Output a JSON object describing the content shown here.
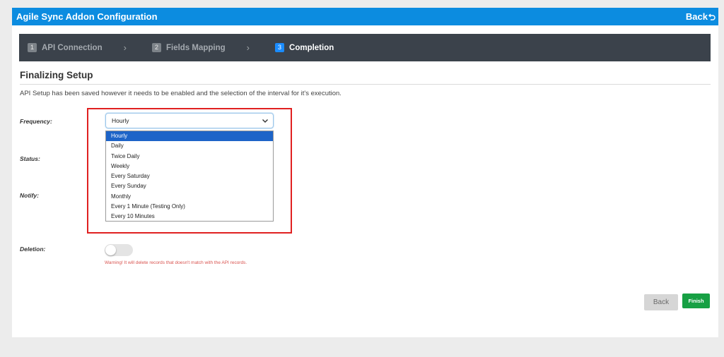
{
  "header": {
    "title": "Agile Sync Addon Configuration",
    "back_label": "Back"
  },
  "wizard": {
    "steps": [
      {
        "num": "1",
        "label": "API Connection"
      },
      {
        "num": "2",
        "label": "Fields Mapping"
      },
      {
        "num": "3",
        "label": "Completion"
      }
    ],
    "active_step": 3
  },
  "section": {
    "title": "Finalizing Setup",
    "intro": "API Setup has been saved however it needs to be enabled and the selection of the interval for it's execution."
  },
  "form": {
    "frequency_label": "Frequency:",
    "status_label": "Status:",
    "notify_label": "Notify:",
    "deletion_label": "Deletion:",
    "frequency_value": "Hourly",
    "frequency_options": [
      "Hourly",
      "Daily",
      "Twice Daily",
      "Weekly",
      "Every Saturday",
      "Every Sunday",
      "Monthly",
      "Every 1 Minute (Testing Only)",
      "Every 10 Minutes"
    ],
    "deletion_enabled": false,
    "deletion_warning": "Warning! It will delete records that doesn't match with the API records."
  },
  "buttons": {
    "back": "Back",
    "finish": "Finish"
  },
  "colors": {
    "header": "#0c8ce0",
    "wizard_bar": "#3b424b",
    "active_step": "#1a8cff",
    "highlight": "#e02020",
    "selected_option": "#1d64c8",
    "finish": "#17a044",
    "warning": "#d9534f"
  }
}
